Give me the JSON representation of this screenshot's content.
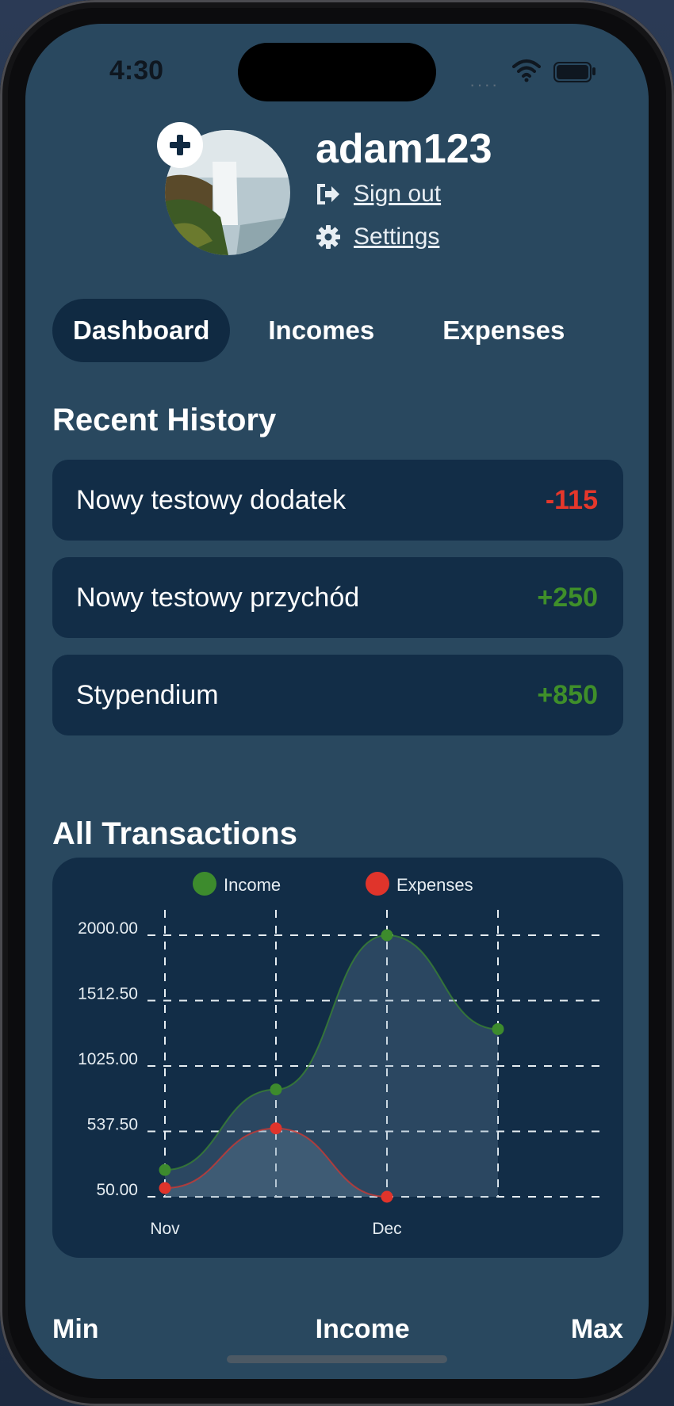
{
  "status_bar": {
    "time": "4:30",
    "signal": "····"
  },
  "profile": {
    "username": "adam123",
    "sign_out_label": "Sign out",
    "settings_label": "Settings",
    "add_icon": "plus-icon"
  },
  "tabs": [
    {
      "label": "Dashboard",
      "active": true
    },
    {
      "label": "Incomes",
      "active": false
    },
    {
      "label": "Expenses",
      "active": false
    }
  ],
  "recent_history": {
    "title": "Recent History",
    "items": [
      {
        "name": "Nowy testowy dodatek",
        "amount": "-115",
        "color": "#e5372b"
      },
      {
        "name": "Nowy testowy przychód",
        "amount": "+250",
        "color": "#3f8f2a"
      },
      {
        "name": "Stypendium",
        "amount": "+850",
        "color": "#3f8f2a"
      }
    ]
  },
  "all_transactions": {
    "title": "All Transactions"
  },
  "chart_data": {
    "type": "area",
    "legend": [
      {
        "name": "Income",
        "color": "#3d8b2d"
      },
      {
        "name": "Expenses",
        "color": "#e0342b"
      }
    ],
    "y_ticks": [
      "2000.00",
      "1512.50",
      "1025.00",
      "537.50",
      "50.00"
    ],
    "x_tick_labels": [
      "Nov",
      "",
      "Dec",
      ""
    ],
    "ylim": [
      50,
      2000
    ],
    "grid": true,
    "series": [
      {
        "name": "Income",
        "values": [
          250,
          850,
          2000,
          1300
        ]
      },
      {
        "name": "Expenses",
        "values": [
          115,
          560,
          50
        ]
      }
    ]
  },
  "summary_labels": {
    "min": "Min",
    "income": "Income",
    "max": "Max"
  }
}
